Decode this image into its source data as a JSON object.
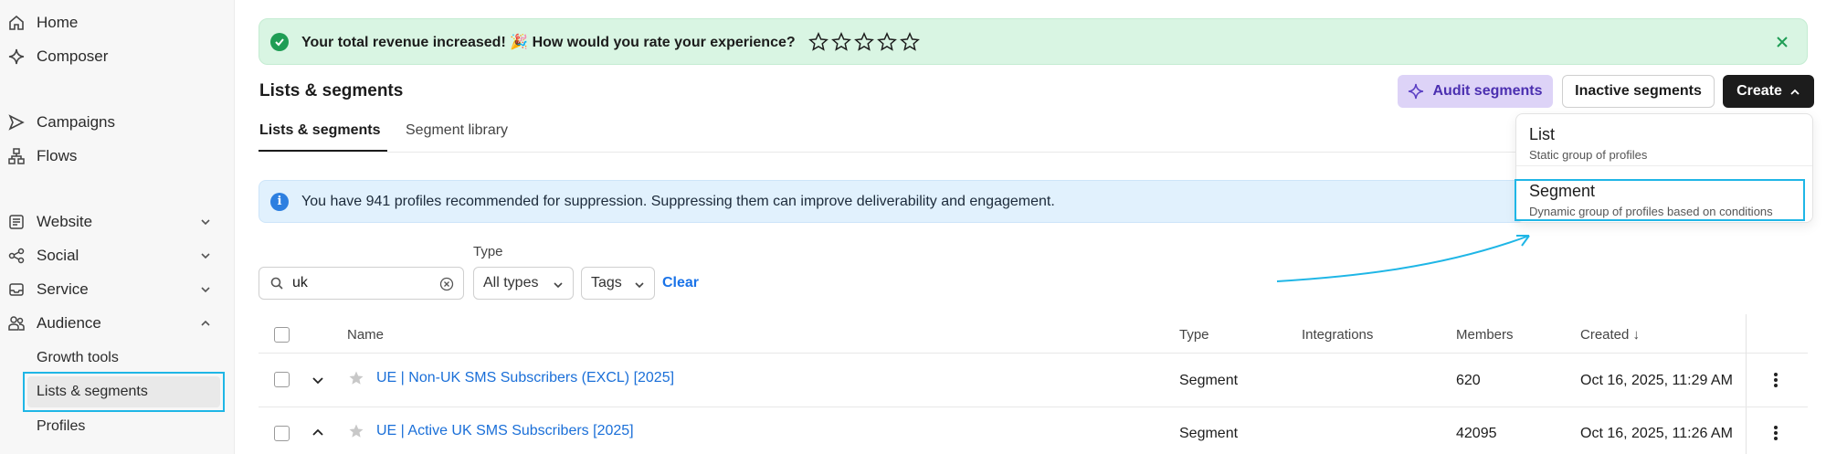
{
  "sidebar": {
    "items": [
      {
        "label": "Home",
        "icon": "home-icon"
      },
      {
        "label": "Composer",
        "icon": "sparkle-icon"
      },
      {
        "label": "Campaigns",
        "icon": "send-icon"
      },
      {
        "label": "Flows",
        "icon": "flows-icon"
      },
      {
        "label": "Website",
        "icon": "document-icon"
      },
      {
        "label": "Social",
        "icon": "share-icon"
      },
      {
        "label": "Service",
        "icon": "inbox-icon"
      },
      {
        "label": "Audience",
        "icon": "people-icon"
      }
    ],
    "audience_sub": [
      "Growth tools",
      "Lists & segments",
      "Profiles"
    ]
  },
  "banner": {
    "message": "Your total revenue increased! 🎉 How would you rate your experience?",
    "rating": {
      "stars": 5,
      "selected": 0
    }
  },
  "header": {
    "title": "Lists & segments",
    "audit_label": "Audit segments",
    "inactive_label": "Inactive segments",
    "create_label": "Create"
  },
  "tabs": [
    {
      "label": "Lists & segments",
      "active": true
    },
    {
      "label": "Segment library",
      "active": false
    }
  ],
  "create_menu": [
    {
      "title": "List",
      "description": "Static group of profiles"
    },
    {
      "title": "Segment",
      "description": "Dynamic group of profiles based on conditions"
    }
  ],
  "info": {
    "message": "You have 941 profiles recommended for suppression. Suppressing them can improve deliverability and engagement."
  },
  "filters": {
    "search_value": "uk",
    "type_label": "Type",
    "type_value": "All types",
    "tags_value": "Tags",
    "clear_label": "Clear"
  },
  "table": {
    "columns": [
      "Name",
      "Type",
      "Integrations",
      "Members",
      "Created ↓"
    ],
    "rows": [
      {
        "name": "UE | Non-UK SMS Subscribers (EXCL) [2025]",
        "type": "Segment",
        "integrations": "",
        "members": "620",
        "created": "Oct 16, 2025, 11:29 AM",
        "expanded": false
      },
      {
        "name": "UE | Active UK SMS Subscribers [2025]",
        "type": "Segment",
        "integrations": "",
        "members": "42095",
        "created": "Oct 16, 2025, 11:26 AM",
        "expanded": true
      }
    ]
  },
  "colors": {
    "accent": "#1a73e8",
    "highlight": "#1fb6e6",
    "success_bg": "#d9f5e3",
    "info_bg": "#e1f1fd",
    "audit_bg": "#ddd3f7"
  }
}
